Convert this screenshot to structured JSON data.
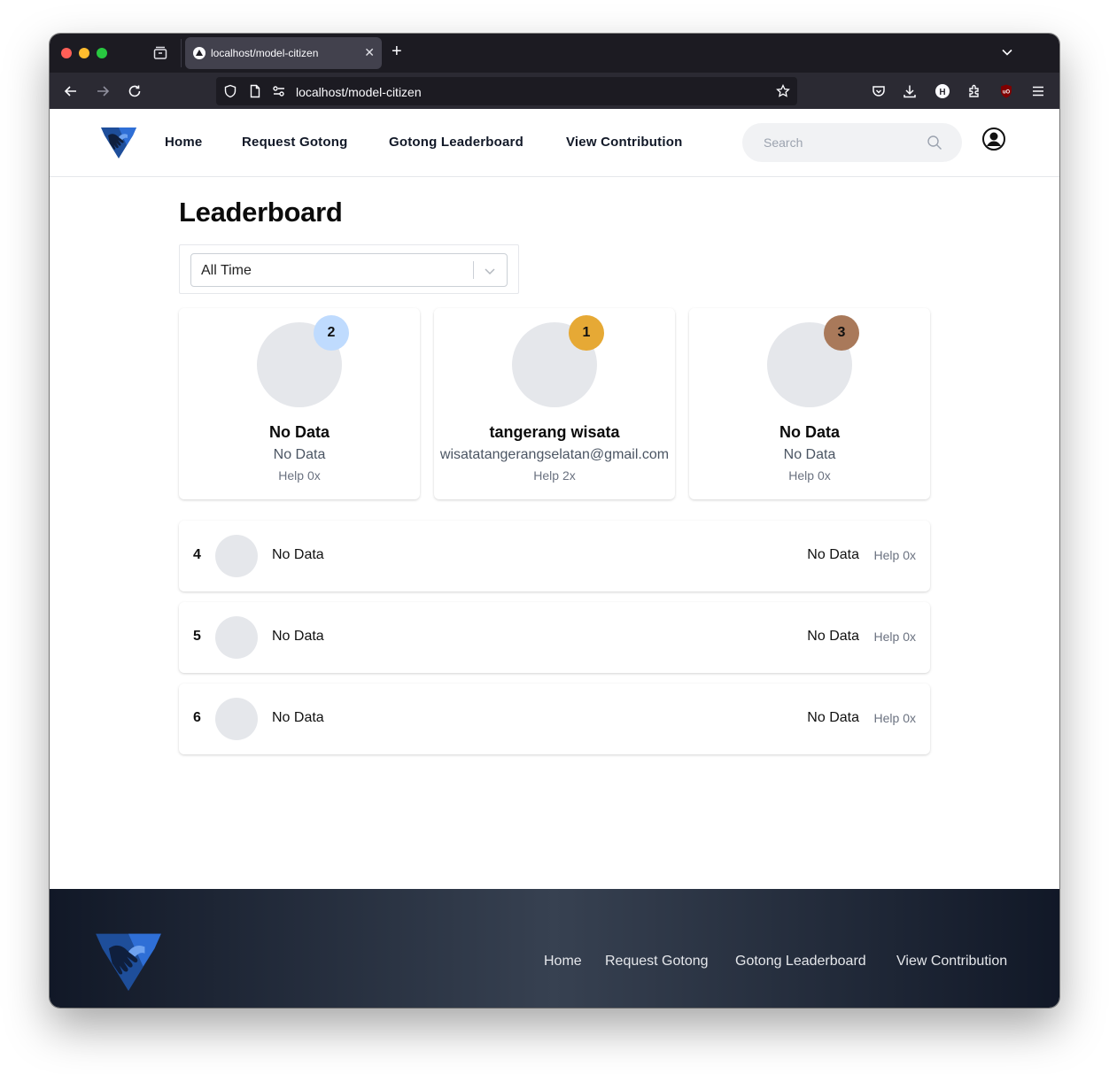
{
  "browser": {
    "tab_title": "localhost/model-citizen",
    "url": "localhost/model-citizen"
  },
  "site": {
    "nav": [
      "Home",
      "Request Gotong",
      "Gotong Leaderboard",
      "View Contribution"
    ],
    "search_placeholder": "Search"
  },
  "leaderboard": {
    "title": "Leaderboard",
    "filter_value": "All Time",
    "podium": [
      {
        "rank": "2",
        "name": "No Data",
        "email": "No Data",
        "help": "Help 0x",
        "badge_color": "#bfdbfe"
      },
      {
        "rank": "1",
        "name": "tangerang wisata",
        "email": "wisatatangerangselatan@gmail.com",
        "help": "Help 2x",
        "badge_color": "#e6a935"
      },
      {
        "rank": "3",
        "name": "No Data",
        "email": "No Data",
        "help": "Help 0x",
        "badge_color": "#a9795a"
      }
    ],
    "rows": [
      {
        "rank": "4",
        "name": "No Data",
        "email": "No Data",
        "help": "Help 0x"
      },
      {
        "rank": "5",
        "name": "No Data",
        "email": "No Data",
        "help": "Help 0x"
      },
      {
        "rank": "6",
        "name": "No Data",
        "email": "No Data",
        "help": "Help 0x"
      }
    ]
  },
  "footer": {
    "nav": [
      "Home",
      "Request Gotong",
      "Gotong Leaderboard",
      "View Contribution"
    ]
  }
}
